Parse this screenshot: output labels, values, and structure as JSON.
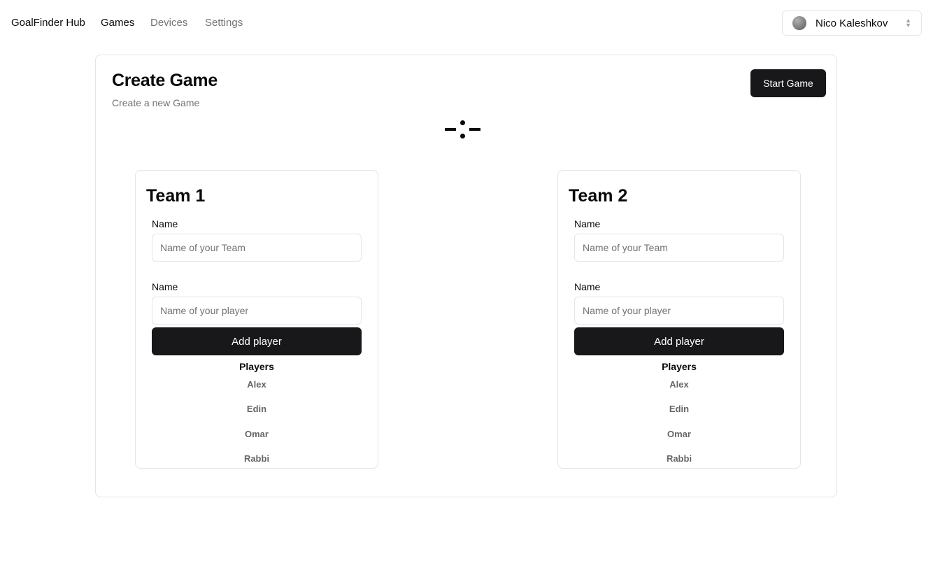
{
  "nav": {
    "brand": "GoalFinder Hub",
    "links": [
      "Games",
      "Devices",
      "Settings"
    ],
    "active": "Games"
  },
  "user": {
    "name": "Nico Kaleshkov",
    "icon": "chevron-up-down-icon"
  },
  "page": {
    "title": "Create Game",
    "subtitle": "Create a new Game",
    "start_label": "Start Game",
    "score_separator": "-:-"
  },
  "teams": [
    {
      "title": "Team 1",
      "team_name_label": "Name",
      "team_name_placeholder": "Name of your Team",
      "player_name_label": "Name",
      "player_name_placeholder": "Name of your player",
      "add_label": "Add player",
      "players_title": "Players",
      "players": [
        "Alex",
        "Edin",
        "Omar",
        "Rabbi"
      ]
    },
    {
      "title": "Team 2",
      "team_name_label": "Name",
      "team_name_placeholder": "Name of your Team",
      "player_name_label": "Name",
      "player_name_placeholder": "Name of your player",
      "add_label": "Add player",
      "players_title": "Players",
      "players": [
        "Alex",
        "Edin",
        "Omar",
        "Rabbi"
      ]
    }
  ],
  "colors": {
    "primary_button": "#18181b",
    "border": "#e5e5e5",
    "muted_text": "#737373"
  }
}
